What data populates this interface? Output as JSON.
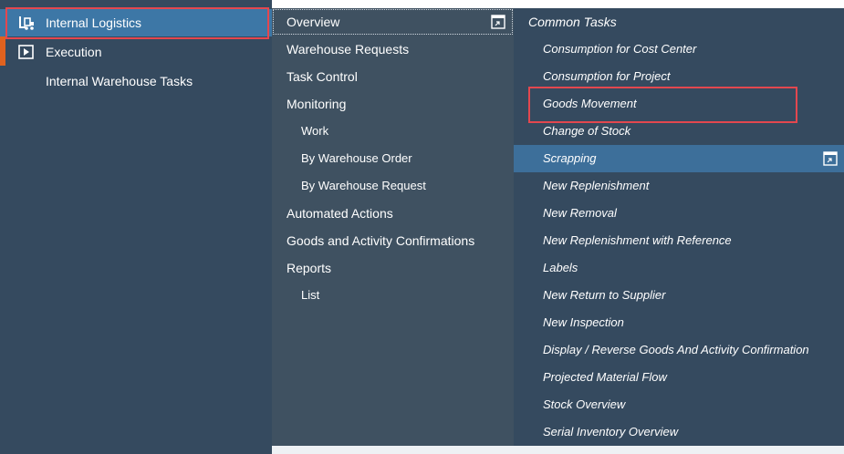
{
  "nav": {
    "items": [
      {
        "label": "Internal Logistics",
        "icon": "forklift-icon"
      },
      {
        "label": "Execution",
        "icon": "play-icon"
      },
      {
        "label": "Internal Warehouse Tasks",
        "icon": ""
      }
    ]
  },
  "menu": {
    "overview": "Overview",
    "items": [
      {
        "label": "Warehouse Requests"
      },
      {
        "label": "Task Control"
      },
      {
        "label": "Monitoring"
      },
      {
        "label": "Work"
      },
      {
        "label": "By Warehouse Order"
      },
      {
        "label": "By Warehouse Request"
      },
      {
        "label": "Automated Actions"
      },
      {
        "label": "Goods and Activity Confirmations"
      },
      {
        "label": "Reports"
      },
      {
        "label": "List"
      }
    ]
  },
  "tasks": {
    "heading": "Common Tasks",
    "items": [
      "Consumption for Cost Center",
      "Consumption for Project",
      "Goods Movement",
      "Change of Stock",
      "Scrapping",
      "New Replenishment",
      "New Removal",
      "New Replenishment with Reference",
      "Labels",
      "New Return to Supplier",
      "New Inspection",
      "Display / Reverse Goods And Activity Confirmation",
      "Projected Material Flow",
      "Stock Overview",
      "Serial Inventory Overview"
    ]
  },
  "colors": {
    "accent": "#e0621f",
    "highlight": "#e3474f",
    "selected": "#3d77a6"
  }
}
